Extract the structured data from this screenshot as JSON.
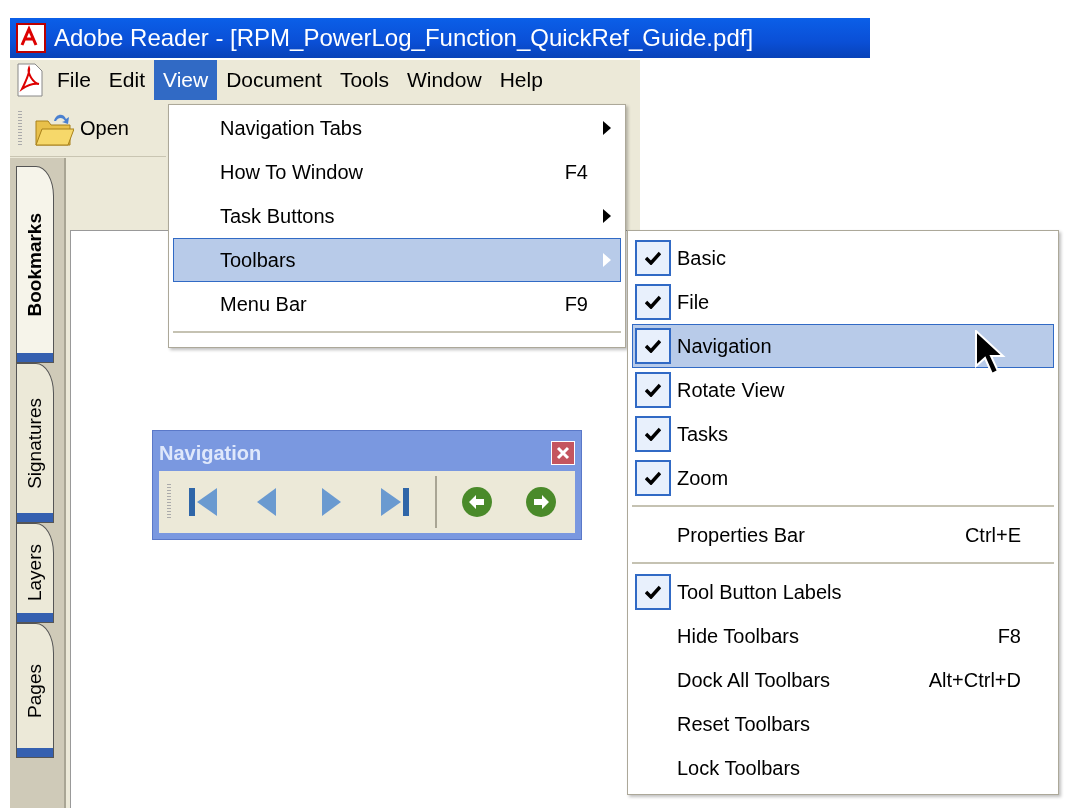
{
  "window": {
    "title": "Adobe Reader - [RPM_PowerLog_Function_QuickRef_Guide.pdf]"
  },
  "menu_bar": [
    {
      "label": "File",
      "selected": false
    },
    {
      "label": "Edit",
      "selected": false
    },
    {
      "label": "View",
      "selected": true
    },
    {
      "label": "Document",
      "selected": false
    },
    {
      "label": "Tools",
      "selected": false
    },
    {
      "label": "Window",
      "selected": false
    },
    {
      "label": "Help",
      "selected": false
    }
  ],
  "toolbar": {
    "buttons": [
      {
        "label": "Open"
      }
    ]
  },
  "side_tabs": [
    {
      "label": "Bookmarks",
      "selected": true
    },
    {
      "label": "Signatures",
      "selected": false
    },
    {
      "label": "Layers",
      "selected": false
    },
    {
      "label": "Pages",
      "selected": false
    }
  ],
  "view_menu": {
    "items": [
      {
        "kind": "submenu",
        "label": "Navigation Tabs",
        "selected": false
      },
      {
        "kind": "command",
        "label": "How To Window",
        "shortcut": "F4",
        "selected": false
      },
      {
        "kind": "submenu",
        "label": "Task Buttons",
        "selected": false
      },
      {
        "kind": "submenu",
        "label": "Toolbars",
        "selected": true
      },
      {
        "kind": "command",
        "label": "Menu Bar",
        "shortcut": "F9",
        "selected": false
      },
      {
        "kind": "separator"
      }
    ]
  },
  "toolbars_submenu": {
    "items": [
      {
        "kind": "check",
        "label": "Basic",
        "checked": true,
        "selected": false
      },
      {
        "kind": "check",
        "label": "File",
        "checked": true,
        "selected": false
      },
      {
        "kind": "check",
        "label": "Navigation",
        "checked": true,
        "selected": true
      },
      {
        "kind": "check",
        "label": "Rotate View",
        "checked": true,
        "selected": false
      },
      {
        "kind": "check",
        "label": "Tasks",
        "checked": true,
        "selected": false
      },
      {
        "kind": "check",
        "label": "Zoom",
        "checked": true,
        "selected": false
      },
      {
        "kind": "separator"
      },
      {
        "kind": "check",
        "label": "Properties Bar",
        "shortcut": "Ctrl+E",
        "checked": false,
        "selected": false
      },
      {
        "kind": "separator"
      },
      {
        "kind": "check",
        "label": "Tool Button Labels",
        "checked": true,
        "selected": false
      },
      {
        "kind": "check",
        "label": "Hide Toolbars",
        "shortcut": "F8",
        "checked": false,
        "selected": false
      },
      {
        "kind": "check",
        "label": "Dock All Toolbars",
        "shortcut": "Alt+Ctrl+D",
        "checked": false,
        "selected": false
      },
      {
        "kind": "check",
        "label": "Reset Toolbars",
        "checked": false,
        "selected": false
      },
      {
        "kind": "check",
        "label": "Lock Toolbars",
        "checked": false,
        "selected": false
      }
    ]
  },
  "navigation_toolbar": {
    "title": "Navigation"
  }
}
